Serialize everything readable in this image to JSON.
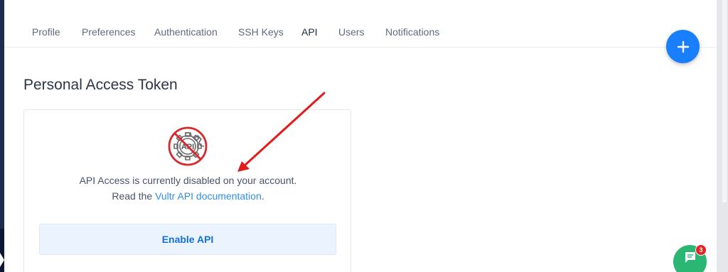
{
  "tabs": [
    {
      "label": "Profile",
      "active": false
    },
    {
      "label": "Preferences",
      "active": false
    },
    {
      "label": "Authentication",
      "active": false
    },
    {
      "label": "SSH Keys",
      "active": false
    },
    {
      "label": "API",
      "active": true
    },
    {
      "label": "Users",
      "active": false
    },
    {
      "label": "Notifications",
      "active": false
    }
  ],
  "fab_icon": "plus-icon",
  "page_title": "Personal Access Token",
  "card": {
    "icon": "api-disabled-icon",
    "icon_text": "API",
    "message": "API Access is currently disabled on your account.",
    "docs_prefix": "Read the ",
    "docs_link": "Vultr API documentation",
    "docs_suffix": ".",
    "enable_button": "Enable API"
  },
  "chat": {
    "icon": "chat-icon",
    "badge_count": "3"
  },
  "colors": {
    "accent": "#1a7fff",
    "danger": "#d9272e",
    "chat": "#2bb673",
    "annotation_arrow": "#e21b1b"
  }
}
